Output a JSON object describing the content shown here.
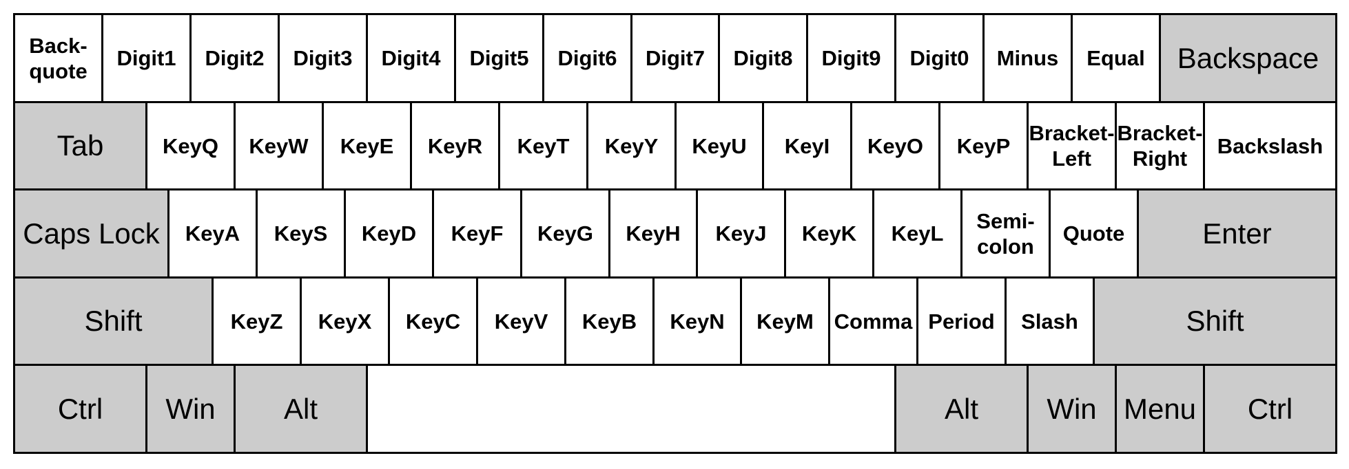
{
  "keyboard": {
    "colors": {
      "character_key": "#ffffff",
      "modifier_key": "#cccccc",
      "border": "#000000",
      "text": "#000000"
    },
    "rows": [
      [
        {
          "id": "Backquote",
          "label": "Back-\nquote",
          "modifier": false
        },
        {
          "id": "Digit1",
          "label": "Digit1",
          "modifier": false
        },
        {
          "id": "Digit2",
          "label": "Digit2",
          "modifier": false
        },
        {
          "id": "Digit3",
          "label": "Digit3",
          "modifier": false
        },
        {
          "id": "Digit4",
          "label": "Digit4",
          "modifier": false
        },
        {
          "id": "Digit5",
          "label": "Digit5",
          "modifier": false
        },
        {
          "id": "Digit6",
          "label": "Digit6",
          "modifier": false
        },
        {
          "id": "Digit7",
          "label": "Digit7",
          "modifier": false
        },
        {
          "id": "Digit8",
          "label": "Digit8",
          "modifier": false
        },
        {
          "id": "Digit9",
          "label": "Digit9",
          "modifier": false
        },
        {
          "id": "Digit0",
          "label": "Digit0",
          "modifier": false
        },
        {
          "id": "Minus",
          "label": "Minus",
          "modifier": false
        },
        {
          "id": "Equal",
          "label": "Equal",
          "modifier": false
        },
        {
          "id": "Backspace",
          "label": "Backspace",
          "modifier": true
        }
      ],
      [
        {
          "id": "Tab",
          "label": "Tab",
          "modifier": true
        },
        {
          "id": "KeyQ",
          "label": "KeyQ",
          "modifier": false
        },
        {
          "id": "KeyW",
          "label": "KeyW",
          "modifier": false
        },
        {
          "id": "KeyE",
          "label": "KeyE",
          "modifier": false
        },
        {
          "id": "KeyR",
          "label": "KeyR",
          "modifier": false
        },
        {
          "id": "KeyT",
          "label": "KeyT",
          "modifier": false
        },
        {
          "id": "KeyY",
          "label": "KeyY",
          "modifier": false
        },
        {
          "id": "KeyU",
          "label": "KeyU",
          "modifier": false
        },
        {
          "id": "KeyI",
          "label": "KeyI",
          "modifier": false
        },
        {
          "id": "KeyO",
          "label": "KeyO",
          "modifier": false
        },
        {
          "id": "KeyP",
          "label": "KeyP",
          "modifier": false
        },
        {
          "id": "BracketLeft",
          "label": "Bracket-\nLeft",
          "modifier": false
        },
        {
          "id": "BracketRight",
          "label": "Bracket-\nRight",
          "modifier": false
        },
        {
          "id": "Backslash",
          "label": "Backslash",
          "modifier": false
        }
      ],
      [
        {
          "id": "CapsLock",
          "label": "Caps Lock",
          "modifier": true
        },
        {
          "id": "KeyA",
          "label": "KeyA",
          "modifier": false
        },
        {
          "id": "KeyS",
          "label": "KeyS",
          "modifier": false
        },
        {
          "id": "KeyD",
          "label": "KeyD",
          "modifier": false
        },
        {
          "id": "KeyF",
          "label": "KeyF",
          "modifier": false
        },
        {
          "id": "KeyG",
          "label": "KeyG",
          "modifier": false
        },
        {
          "id": "KeyH",
          "label": "KeyH",
          "modifier": false
        },
        {
          "id": "KeyJ",
          "label": "KeyJ",
          "modifier": false
        },
        {
          "id": "KeyK",
          "label": "KeyK",
          "modifier": false
        },
        {
          "id": "KeyL",
          "label": "KeyL",
          "modifier": false
        },
        {
          "id": "Semicolon",
          "label": "Semi-\ncolon",
          "modifier": false
        },
        {
          "id": "Quote",
          "label": "Quote",
          "modifier": false
        },
        {
          "id": "Enter",
          "label": "Enter",
          "modifier": true
        }
      ],
      [
        {
          "id": "ShiftLeft",
          "label": "Shift",
          "modifier": true
        },
        {
          "id": "KeyZ",
          "label": "KeyZ",
          "modifier": false
        },
        {
          "id": "KeyX",
          "label": "KeyX",
          "modifier": false
        },
        {
          "id": "KeyC",
          "label": "KeyC",
          "modifier": false
        },
        {
          "id": "KeyV",
          "label": "KeyV",
          "modifier": false
        },
        {
          "id": "KeyB",
          "label": "KeyB",
          "modifier": false
        },
        {
          "id": "KeyN",
          "label": "KeyN",
          "modifier": false
        },
        {
          "id": "KeyM",
          "label": "KeyM",
          "modifier": false
        },
        {
          "id": "Comma",
          "label": "Comma",
          "modifier": false
        },
        {
          "id": "Period",
          "label": "Period",
          "modifier": false
        },
        {
          "id": "Slash",
          "label": "Slash",
          "modifier": false
        },
        {
          "id": "ShiftRight",
          "label": "Shift",
          "modifier": true
        }
      ],
      [
        {
          "id": "ControlLeft",
          "label": "Ctrl",
          "modifier": true
        },
        {
          "id": "MetaLeft",
          "label": "Win",
          "modifier": true
        },
        {
          "id": "AltLeft",
          "label": "Alt",
          "modifier": true
        },
        {
          "id": "Space",
          "label": "",
          "modifier": false
        },
        {
          "id": "AltRight",
          "label": "Alt",
          "modifier": true
        },
        {
          "id": "MetaRight",
          "label": "Win",
          "modifier": true
        },
        {
          "id": "ContextMenu",
          "label": "Menu",
          "modifier": true
        },
        {
          "id": "ControlRight",
          "label": "Ctrl",
          "modifier": true
        }
      ]
    ]
  }
}
